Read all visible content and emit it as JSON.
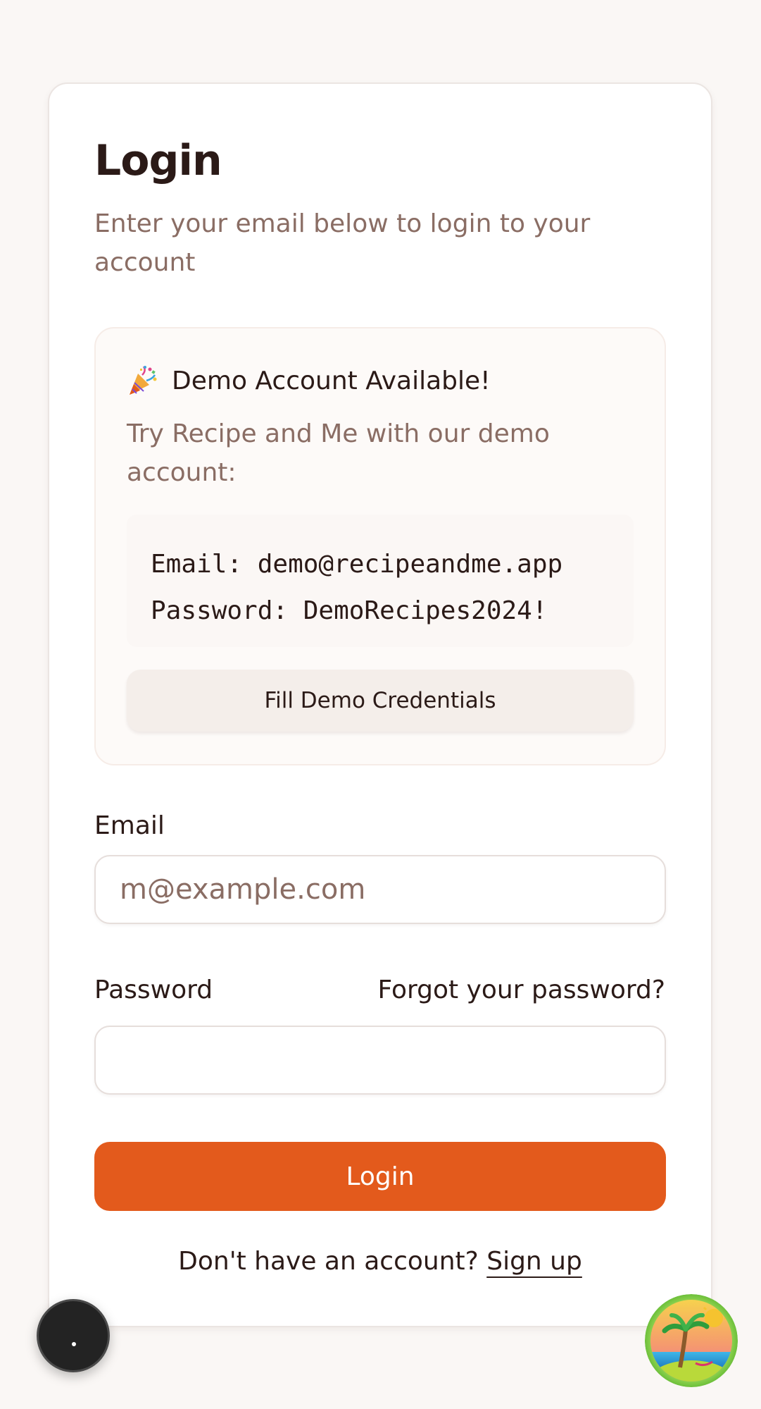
{
  "login": {
    "title": "Login",
    "subtitle": "Enter your email below to login to your account"
  },
  "demo": {
    "icon": "party-popper-icon",
    "title": "Demo Account Available!",
    "description": "Try Recipe and Me with our demo account:",
    "email_line": "Email: demo@recipeandme.app",
    "password_line": "Password: DemoRecipes2024!",
    "fill_button": "Fill Demo Credentials"
  },
  "form": {
    "email_label": "Email",
    "email_placeholder": "m@example.com",
    "email_value": "",
    "password_label": "Password",
    "password_value": "",
    "forgot_link": "Forgot your password?",
    "submit_label": "Login"
  },
  "footer": {
    "prompt": "Don't have an account?",
    "signup_link": "Sign up"
  },
  "floating": {
    "dev_tools_icon": "dev-tools-icon",
    "avatar_icon": "beach-avatar-icon"
  },
  "colors": {
    "accent": "#e35a1c",
    "background": "#faf7f5",
    "text": "#2b1a17",
    "muted_text": "#8a6d64"
  }
}
